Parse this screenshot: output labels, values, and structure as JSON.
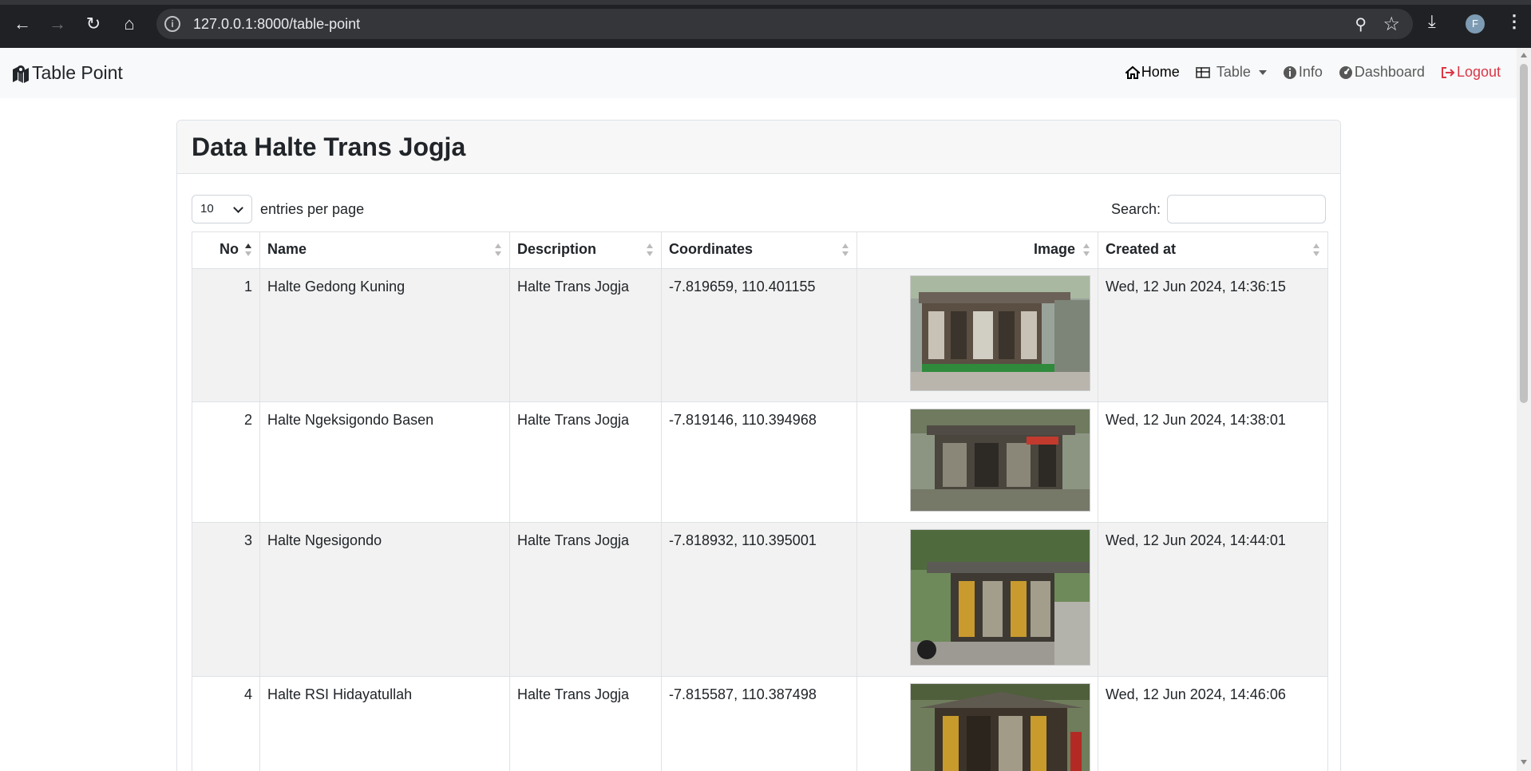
{
  "browser": {
    "url": "127.0.0.1:8000/table-point",
    "profile_initial": "F"
  },
  "navbar": {
    "brand": "Table Point",
    "links": {
      "home": "Home",
      "table": "Table",
      "info": "Info",
      "dashboard": "Dashboard",
      "logout": "Logout"
    },
    "logout_color": "#dc3545"
  },
  "card": {
    "title": "Data Halte Trans Jogja"
  },
  "datatable": {
    "entries_value": "10",
    "entries_label": "entries per page",
    "search_label": "Search:",
    "columns": [
      "No",
      "Name",
      "Description",
      "Coordinates",
      "Image",
      "Created at"
    ],
    "rows": [
      {
        "no": "1",
        "name": "Halte Gedong Kuning",
        "description": "Halte Trans Jogja",
        "coordinates": "-7.819659, 110.401155",
        "created_at": "Wed, 12 Jun 2024, 14:36:15"
      },
      {
        "no": "2",
        "name": "Halte Ngeksigondo Basen",
        "description": "Halte Trans Jogja",
        "coordinates": "-7.819146, 110.394968",
        "created_at": "Wed, 12 Jun 2024, 14:38:01"
      },
      {
        "no": "3",
        "name": "Halte Ngesigondo",
        "description": "Halte Trans Jogja",
        "coordinates": "-7.818932, 110.395001",
        "created_at": "Wed, 12 Jun 2024, 14:44:01"
      },
      {
        "no": "4",
        "name": "Halte RSI Hidayatullah",
        "description": "Halte Trans Jogja",
        "coordinates": "-7.815587, 110.387498",
        "created_at": "Wed, 12 Jun 2024, 14:46:06"
      }
    ]
  }
}
